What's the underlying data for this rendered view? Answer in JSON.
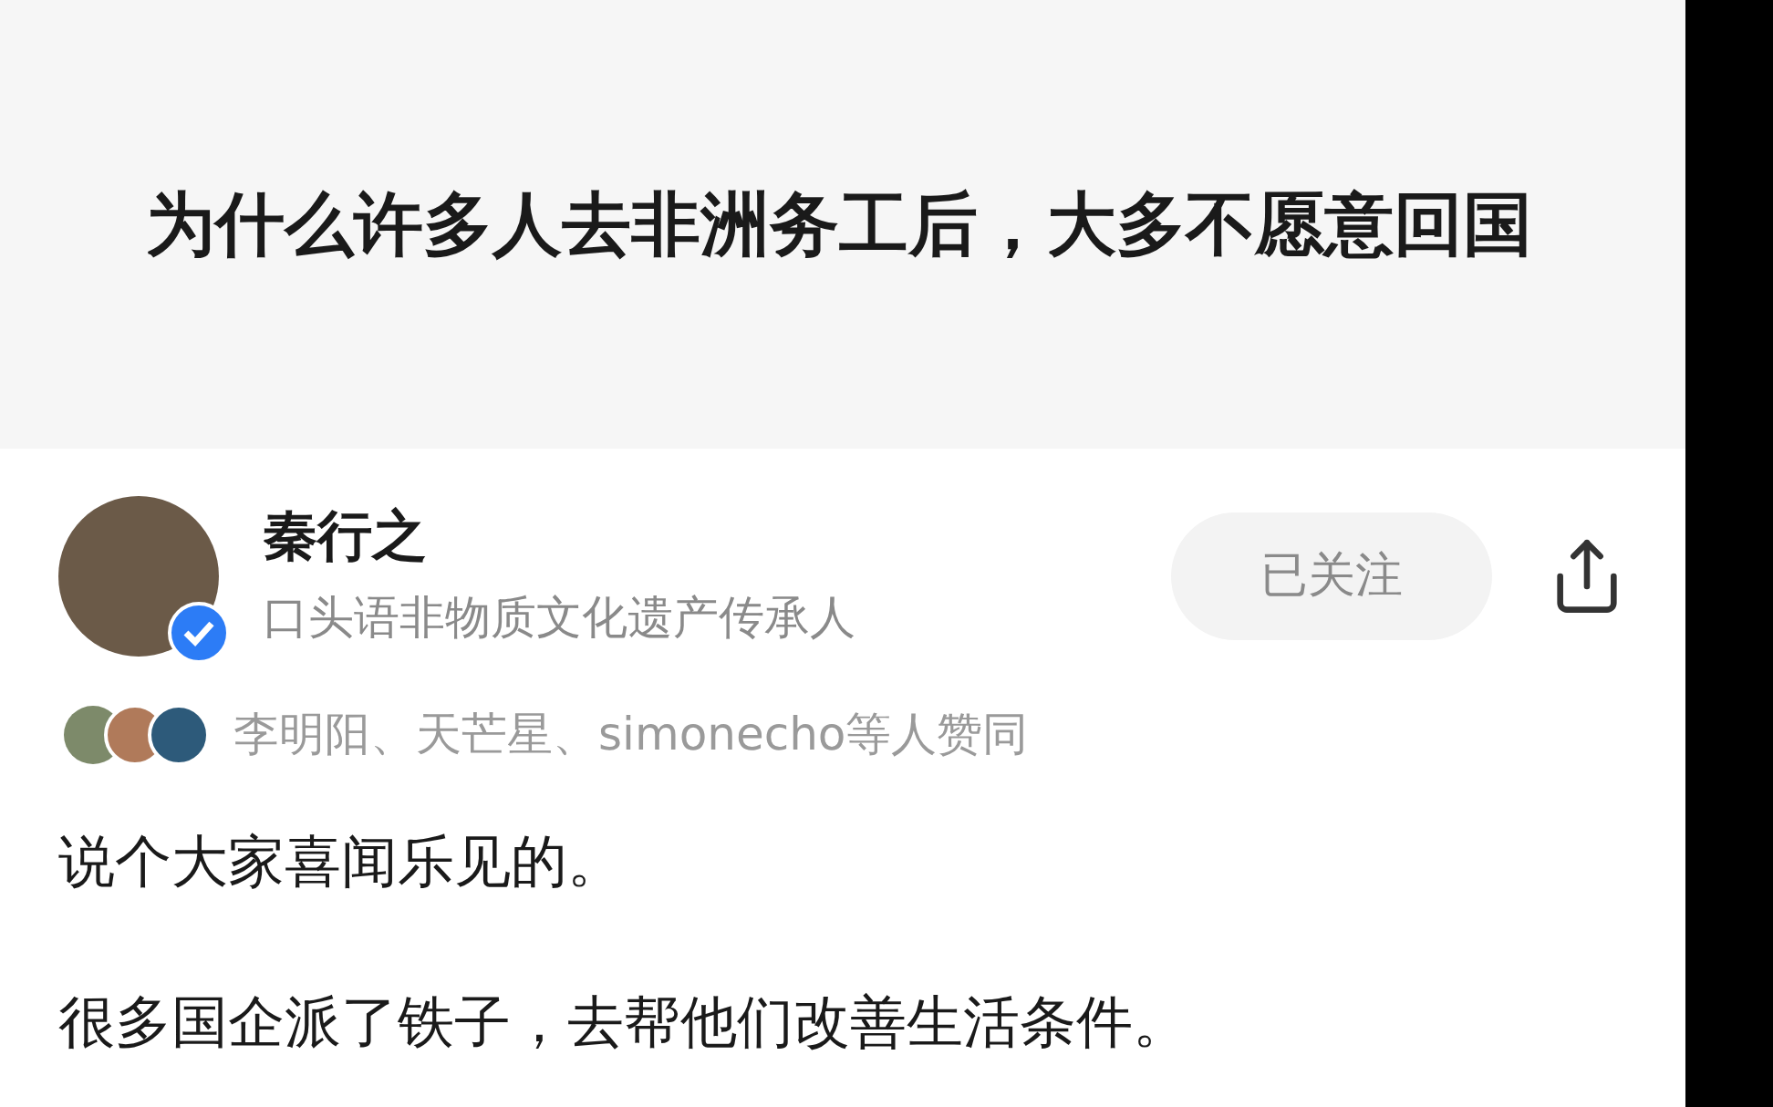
{
  "question": {
    "title": "为什么许多人去非洲务工后，大多不愿意回国"
  },
  "author": {
    "name": "秦行之",
    "bio": "口头语非物质文化遗产传承人",
    "verified": true,
    "follow_button": {
      "label": "已关注",
      "following": true
    }
  },
  "endorsement": {
    "text": "李明阳、天芒星、simonecho等人赞同"
  },
  "answer": {
    "paragraphs": [
      "说个大家喜闻乐见的。",
      "很多国企派了铁子，去帮他们改善生活条件。"
    ]
  }
}
